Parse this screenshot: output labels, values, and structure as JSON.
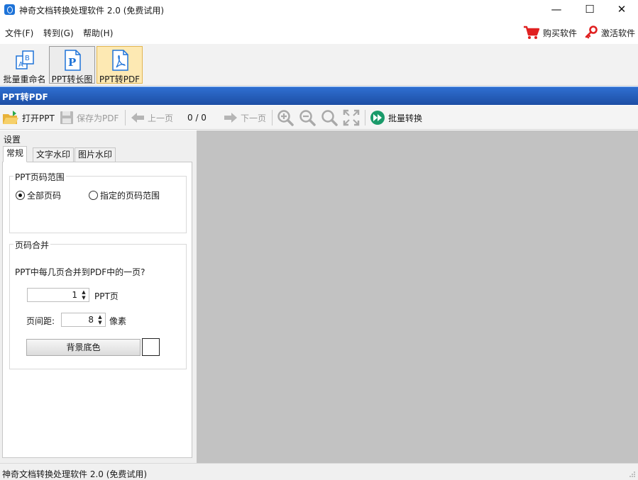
{
  "window": {
    "title": "神奇文档转换处理软件 2.0 (免费试用)",
    "minimize_glyph": "—",
    "maximize_glyph": "☐",
    "close_glyph": "✕"
  },
  "menu": {
    "items": [
      {
        "label": "文件(F)"
      },
      {
        "label": "转到(G)"
      },
      {
        "label": "帮助(H)"
      }
    ],
    "buy_label": "购买软件",
    "activate_label": "激活软件"
  },
  "ribbon": {
    "buttons": [
      {
        "label": "批量重命名",
        "icon": "rename-icon"
      },
      {
        "label": "PPT转长图",
        "icon": "ppt-icon"
      },
      {
        "label": "PPT转PDF",
        "icon": "pdf-icon"
      }
    ]
  },
  "module_title": "PPT转PDF",
  "toolbar": {
    "open_label": "打开PPT",
    "save_label": "保存为PDF",
    "prev_label": "上一页",
    "page_counter": "0 / 0",
    "next_label": "下一页",
    "batch_label": "批量转换"
  },
  "settings": {
    "header": "设置",
    "tabs": [
      "常规",
      "文字水印",
      "图片水印"
    ],
    "page_range": {
      "title": "PPT页码范围",
      "option_all": "全部页码",
      "option_custom": "指定的页码范围",
      "selected": "all"
    },
    "merge": {
      "title": "页码合并",
      "question": "PPT中每几页合并到PDF中的一页?",
      "pages_value": "1",
      "pages_unit": "PPT页",
      "spacing_label": "页间距:",
      "spacing_value": "8",
      "spacing_unit": "像素",
      "bg_button_label": "背景底色",
      "bg_color": "#ffffff"
    }
  },
  "status": {
    "text": "神奇文档转换处理软件 2.0 (免费试用)"
  },
  "colors": {
    "accent_blue": "#1d4ea4",
    "preview_gray": "#c2c2c2",
    "cart_red": "#e02020",
    "batch_green": "#1a9a6a"
  }
}
